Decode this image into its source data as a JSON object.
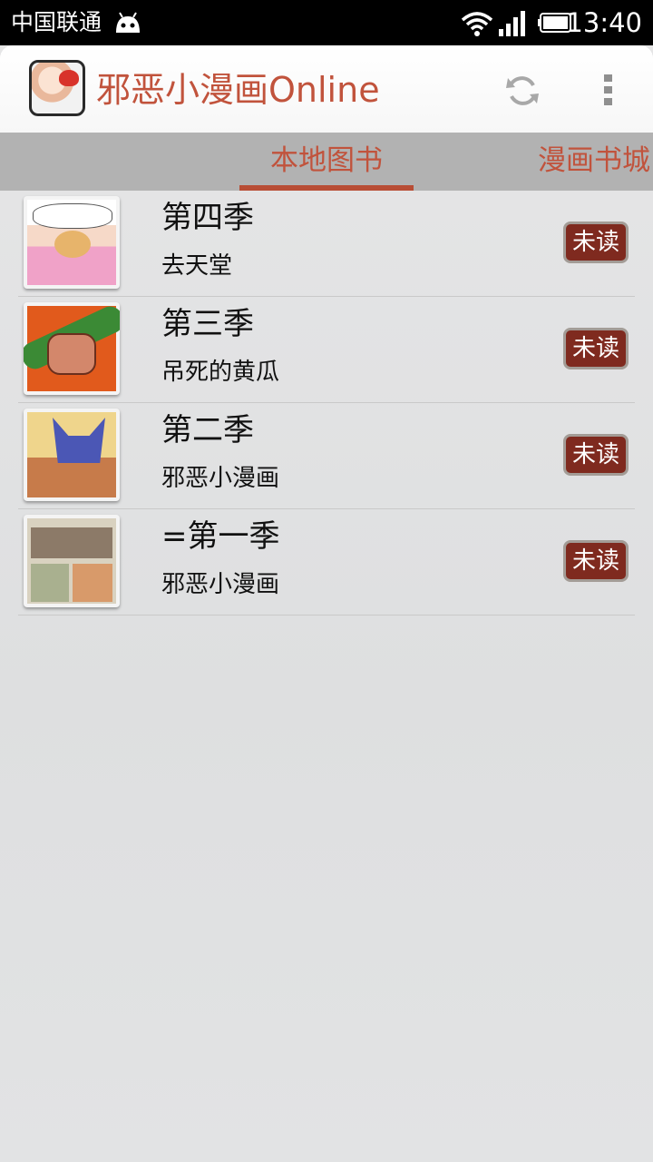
{
  "status_bar": {
    "carrier": "中国联通",
    "time": "13:40",
    "icons": [
      "android-icon",
      "wifi-icon",
      "signal-icon",
      "battery-icon"
    ]
  },
  "action_bar": {
    "app_title": "邪恶小漫画Online",
    "icons": [
      "app-icon",
      "refresh-icon",
      "overflow-menu-icon"
    ]
  },
  "tabs": [
    {
      "label": "本地图书",
      "selected": true
    },
    {
      "label": "漫画书城",
      "selected": false
    }
  ],
  "books": [
    {
      "title": "第四季",
      "subtitle": "去天堂",
      "status": "未读"
    },
    {
      "title": "第三季",
      "subtitle": "吊死的黄瓜",
      "status": "未读"
    },
    {
      "title": "第二季",
      "subtitle": "邪恶小漫画",
      "status": "未读"
    },
    {
      "title": "=第一季",
      "subtitle": "邪恶小漫画",
      "status": "未读"
    }
  ],
  "colors": {
    "accent": "#c1533c",
    "badge_bg": "#7f2a1f",
    "tab_bar_bg": "#b2b2b2",
    "status_bar_bg": "#000000"
  }
}
